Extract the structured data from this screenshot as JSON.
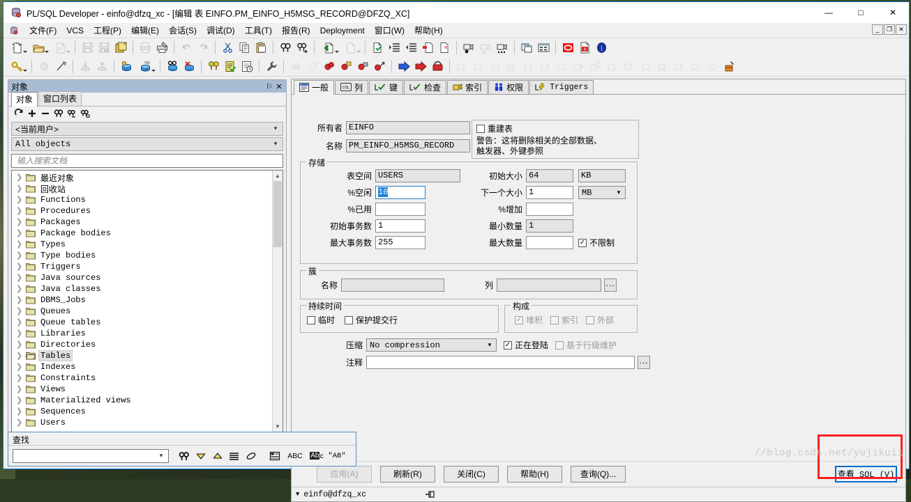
{
  "window": {
    "title": "PL/SQL Developer - einfo@dfzq_xc - [编辑 表 EINFO.PM_EINFO_H5MSG_RECORD@DFZQ_XC]",
    "minimize": "—",
    "maximize": "□",
    "close": "✕",
    "mdi_restore": "_",
    "mdi_max": "❐",
    "mdi_close": "✕"
  },
  "menu": {
    "items": [
      "文件(F)",
      "VCS",
      "工程(P)",
      "编辑(E)",
      "会话(S)",
      "调试(D)",
      "工具(T)",
      "报告(R)",
      "Deployment",
      "窗口(W)",
      "帮助(H)"
    ]
  },
  "object_panel": {
    "header_title": "对象",
    "pin": "⚐",
    "close": "✕",
    "tabs": [
      {
        "label": "对象",
        "active": true
      },
      {
        "label": "窗口列表",
        "active": false
      }
    ],
    "toolbar_icons": [
      "refresh-icon",
      "expand-icon",
      "collapse-icon",
      "find-icon",
      "find-next-icon",
      "find-prev-icon"
    ],
    "user_combo": "<当前用户>",
    "filter_combo": "All objects",
    "search_placeholder": "输入搜索文档",
    "search_value": "",
    "tree_items": [
      {
        "label": "最近对象",
        "selected": false
      },
      {
        "label": "回收站",
        "selected": false
      },
      {
        "label": "Functions",
        "selected": false
      },
      {
        "label": "Procedures",
        "selected": false
      },
      {
        "label": "Packages",
        "selected": false
      },
      {
        "label": "Package bodies",
        "selected": false
      },
      {
        "label": "Types",
        "selected": false
      },
      {
        "label": "Type bodies",
        "selected": false
      },
      {
        "label": "Triggers",
        "selected": false
      },
      {
        "label": "Java sources",
        "selected": false
      },
      {
        "label": "Java classes",
        "selected": false
      },
      {
        "label": "DBMS_Jobs",
        "selected": false
      },
      {
        "label": "Queues",
        "selected": false
      },
      {
        "label": "Queue tables",
        "selected": false
      },
      {
        "label": "Libraries",
        "selected": false
      },
      {
        "label": "Directories",
        "selected": false
      },
      {
        "label": "Tables",
        "selected": true
      },
      {
        "label": "Indexes",
        "selected": false
      },
      {
        "label": "Constraints",
        "selected": false
      },
      {
        "label": "Views",
        "selected": false
      },
      {
        "label": "Materialized views",
        "selected": false
      },
      {
        "label": "Sequences",
        "selected": false
      },
      {
        "label": "Users",
        "selected": false
      }
    ]
  },
  "editor": {
    "tabs": [
      {
        "label": "一般",
        "icon": "general-icon",
        "active": true,
        "mono": false
      },
      {
        "label": "列",
        "icon": "columns-icon",
        "active": false,
        "mono": false
      },
      {
        "label": "键",
        "icon": "keys-icon",
        "active": false,
        "mono": false
      },
      {
        "label": "检查",
        "icon": "checks-icon",
        "active": false,
        "mono": false
      },
      {
        "label": "索引",
        "icon": "indexes-icon",
        "active": false,
        "mono": false
      },
      {
        "label": "权限",
        "icon": "privileges-icon",
        "active": false,
        "mono": false
      },
      {
        "label": "Triggers",
        "icon": "triggers-icon",
        "active": false,
        "mono": true
      }
    ],
    "general": {
      "owner_label": "所有者",
      "owner_value": "EINFO",
      "name_label": "名称",
      "name_value": "PM_EINFO_H5MSG_RECORD",
      "rebuild_checkbox_label": "重建表",
      "rebuild_checked": false,
      "warning_line1": "警告：这将删除相关的全部数据、",
      "warning_line2": "触发器、外键参照"
    },
    "storage": {
      "title": "存储",
      "tablespace_label": "表空间",
      "tablespace_value": "USERS",
      "pct_free_label": "%空闲",
      "pct_free_value": "10",
      "pct_used_label": "%已用",
      "pct_used_value": "",
      "initrans_label": "初始事务数",
      "initrans_value": "1",
      "maxtrans_label": "最大事务数",
      "maxtrans_value": "255",
      "initial_size_label": "初始大小",
      "initial_size_value": "64",
      "initial_size_unit": "KB",
      "next_size_label": "下一个大小",
      "next_size_value": "1",
      "next_size_unit": "MB",
      "pct_increase_label": "%增加",
      "pct_increase_value": "",
      "min_extents_label": "最小数量",
      "min_extents_value": "1",
      "max_extents_label": "最大数量",
      "max_extents_value": "",
      "unlimited_label": "不限制",
      "unlimited_checked": true
    },
    "cluster": {
      "title": "簇",
      "name_label": "名称",
      "name_value": "",
      "columns_label": "列",
      "columns_value": "",
      "browse_button": "..."
    },
    "duration": {
      "title": "持续时间",
      "temporary_label": "临时",
      "temporary_checked": false,
      "preserve_rows_label": "保护提交行",
      "preserve_rows_checked": false
    },
    "organization": {
      "title": "构成",
      "heap_label": "堆积",
      "heap_checked": true,
      "index_label": "索引",
      "index_checked": false,
      "external_label": "外部",
      "external_checked": false
    },
    "bottom": {
      "compression_label": "压缩",
      "compression_value": "No compression",
      "logging_label": "正在登陆",
      "logging_checked": true,
      "row_movement_label": "基于行级维护",
      "row_movement_checked": false,
      "comment_label": "注释",
      "comment_value": "",
      "comment_browse": "..."
    },
    "buttons": [
      {
        "label": "应用(A)",
        "disabled": true,
        "name": "apply-button"
      },
      {
        "label": "刷新(R)",
        "disabled": false,
        "name": "refresh-button"
      },
      {
        "label": "关闭(C)",
        "disabled": false,
        "name": "close-button"
      },
      {
        "label": "帮助(H)",
        "disabled": false,
        "name": "help-button"
      },
      {
        "label": "查询(Q)...",
        "disabled": false,
        "name": "query-button"
      }
    ],
    "view_sql_button": "查看 SQL (V)",
    "status_connection": "einfo@dfzq_xc"
  },
  "find_bar": {
    "title": "查找",
    "input_value": "",
    "buttons": [
      "find-icon",
      "find-down-icon",
      "find-up-icon",
      "find-all-icon",
      "highlight-icon",
      "panel-icon",
      "case-abc-icon",
      "match-case-icon",
      "whole-word-icon"
    ],
    "labels": {
      "abc": "ABC",
      "match": "Ab",
      "whole": "\"AB\""
    }
  },
  "watermark": "//blog.csdn.net/yujikui1",
  "colors": {
    "panel_header": "#a8bcd4",
    "window_border": "#0078d7",
    "highlight_red": "#ff2020",
    "focus_blue": "#0a6cc4",
    "selection_blue": "#1a7fd4"
  }
}
